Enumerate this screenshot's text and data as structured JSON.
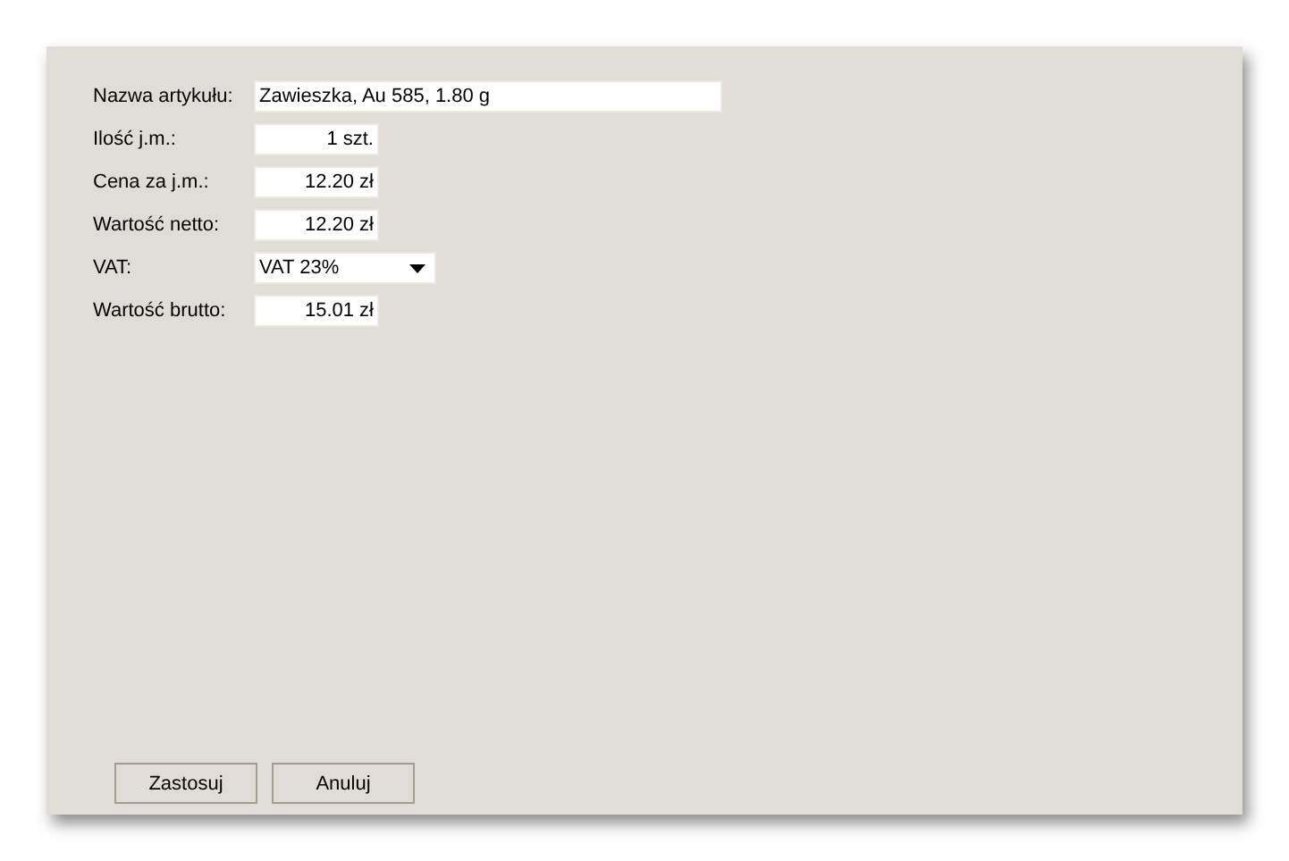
{
  "fields": [
    {
      "label": "Nazwa artykułu:",
      "kind": "text",
      "value": "Zawieszka, Au 585, 1.80 g"
    },
    {
      "label": "Ilość j.m.:",
      "kind": "number",
      "value": "1 szt."
    },
    {
      "label": "Cena za j.m.:",
      "kind": "number",
      "value": "12.20 zł"
    },
    {
      "label": "Wartość netto:",
      "kind": "number",
      "value": "12.20 zł"
    },
    {
      "label": "VAT:",
      "kind": "select",
      "value": "VAT 23%"
    },
    {
      "label": "Wartość brutto:",
      "kind": "number",
      "value": "15.01 zł"
    }
  ],
  "buttons": [
    "Zastosuj",
    "Anuluj"
  ]
}
